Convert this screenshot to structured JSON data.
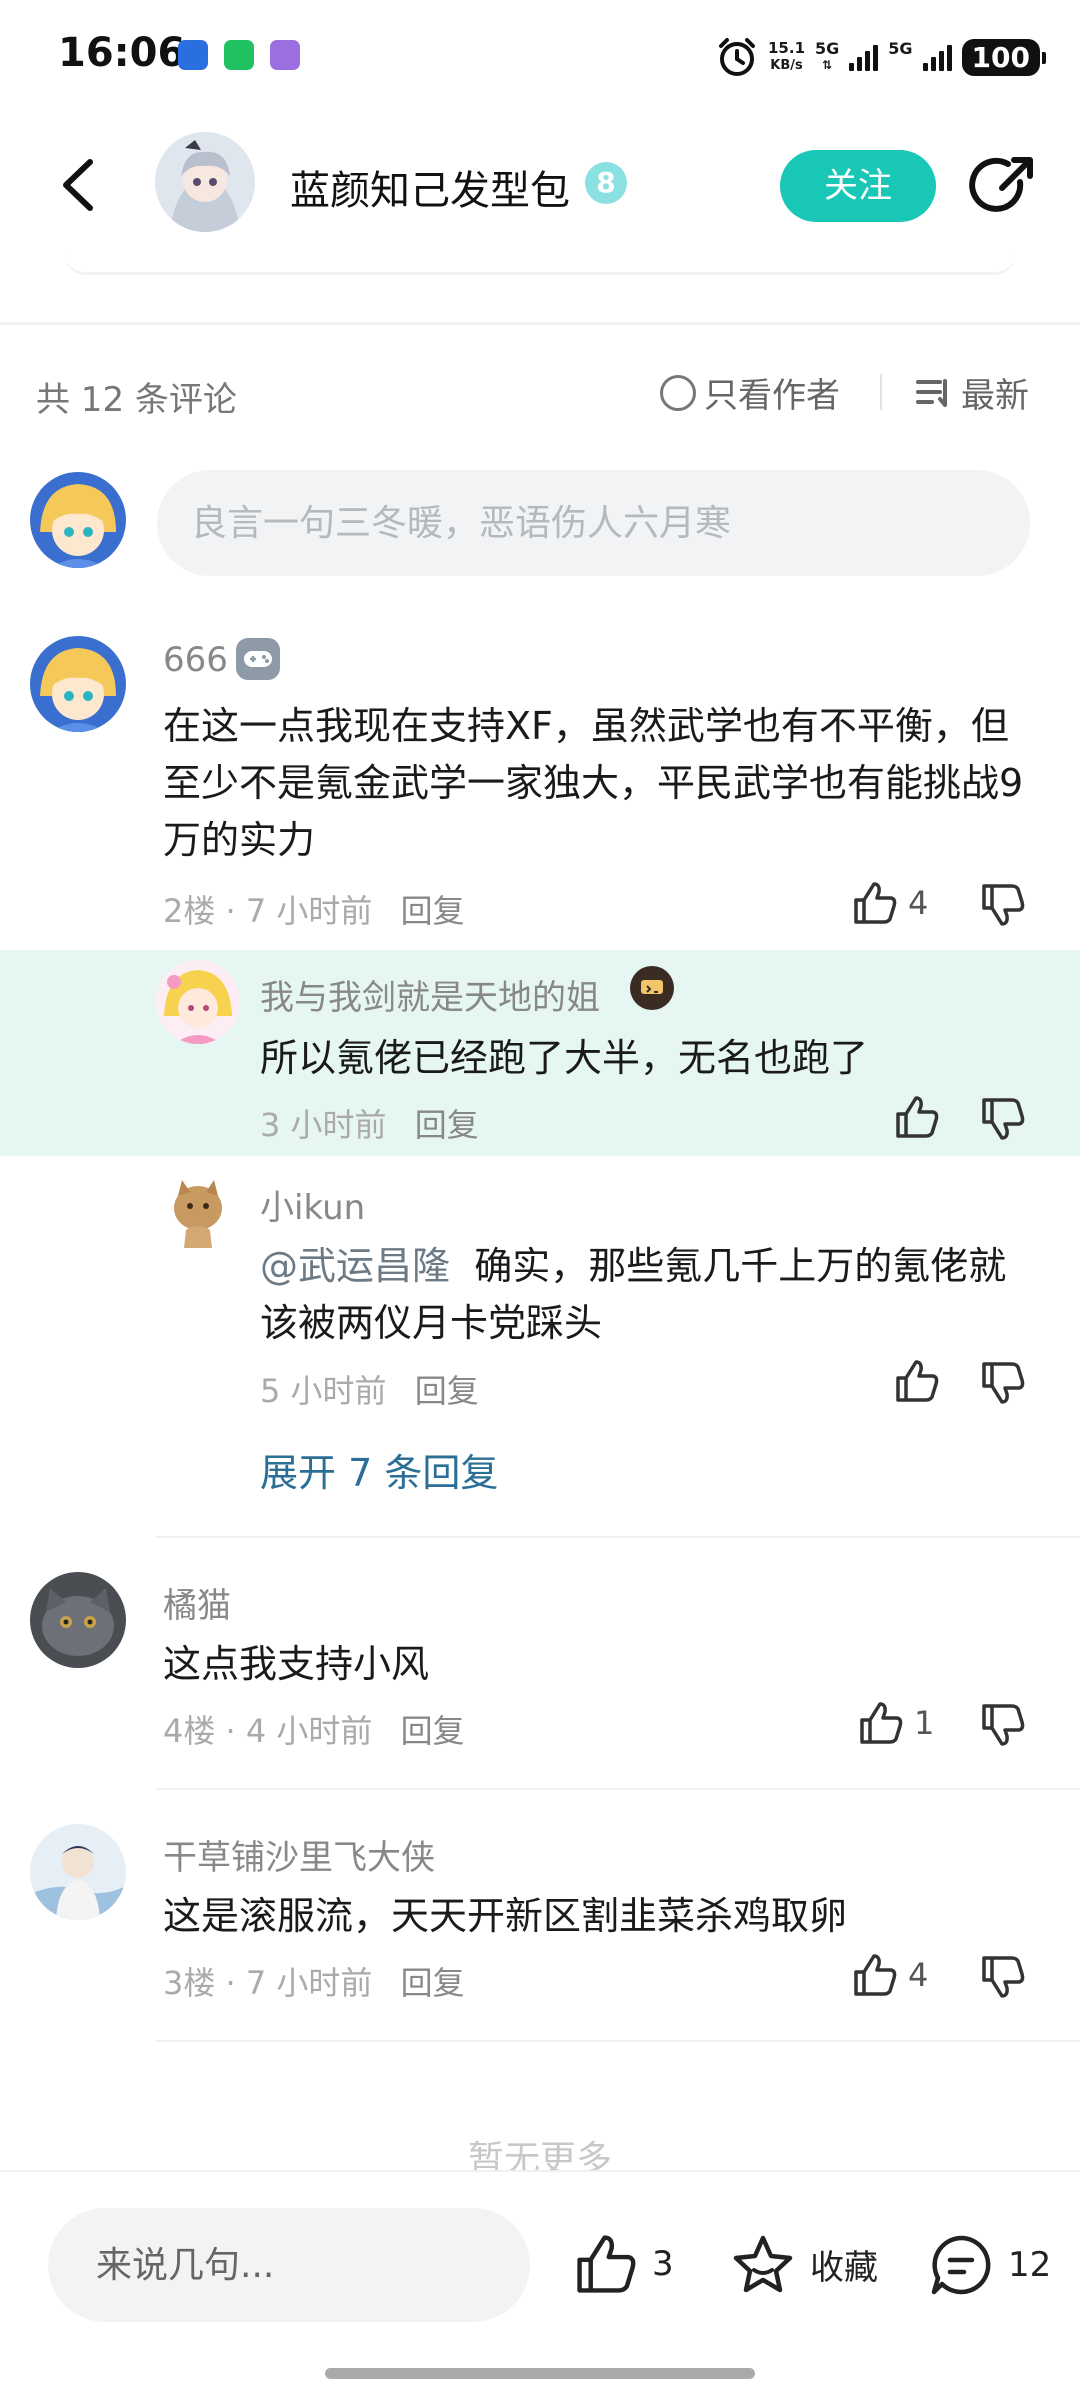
{
  "status_bar": {
    "time": "16:06",
    "speed_value": "15.1",
    "speed_unit": "KB/s",
    "net1": "5G",
    "net2": "5G",
    "battery": "100",
    "app_icons": [
      "blue-app-icon",
      "wechat-icon",
      "purple-app-icon"
    ]
  },
  "header": {
    "title": "蓝颜知己发型包",
    "level": "8",
    "follow_label": "关注"
  },
  "toolbar": {
    "count": "共 12 条评论",
    "author_only": "只看作者",
    "sort": "最新"
  },
  "comment_input": {
    "placeholder": "良言一句三冬暖，恶语伤人六月寒"
  },
  "comments": [
    {
      "user": "666",
      "text": "在这一点我现在支持XF，虽然武学也有不平衡，但至少不是氪金武学一家独大，平民武学也有能挑战9万的实力",
      "floor": "2楼",
      "time": "7 小时前",
      "reply": "回复",
      "likes": "4",
      "replies": [
        {
          "user": "我与我剑就是天地的姐",
          "text": "所以氪佬已经跑了大半，无名也跑了",
          "time": "3 小时前",
          "reply": "回复"
        },
        {
          "user": "小ikun",
          "mention": "@武运昌隆",
          "text": "确实，那些氪几千上万的氪佬就该被两仪月卡党踩头",
          "time": "5 小时前",
          "reply": "回复"
        }
      ],
      "expand": "展开 7 条回复"
    },
    {
      "user": "橘猫",
      "text": "这点我支持小风",
      "floor": "4楼",
      "time": "4 小时前",
      "reply": "回复",
      "likes": "1"
    },
    {
      "user": "干草铺沙里飞大侠",
      "text": "这是滚服流，天天开新区割韭菜杀鸡取卵",
      "floor": "3楼",
      "time": "7 小时前",
      "reply": "回复",
      "likes": "4"
    }
  ],
  "no_more": "暂无更多",
  "bottom_bar": {
    "input_placeholder": "来说几句...",
    "likes": "3",
    "collect": "收藏",
    "comments": "12"
  },
  "colors": {
    "accent": "#19c7b6",
    "highlight": "#e6f6f3",
    "link": "#2b6e96"
  }
}
